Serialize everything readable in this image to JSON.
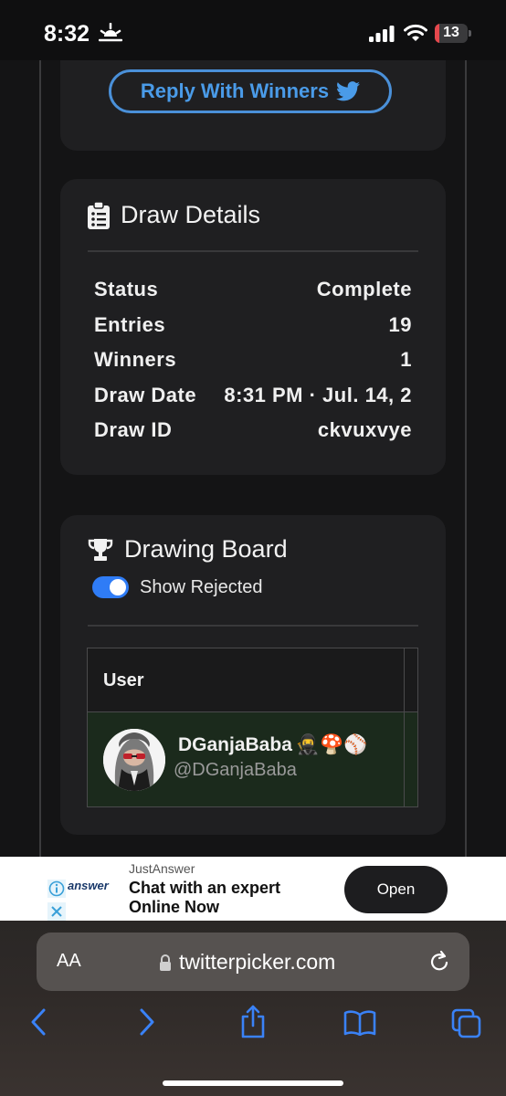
{
  "status_bar": {
    "time": "8:32",
    "battery": "13",
    "battery_level": 0.13
  },
  "card_top": {
    "reply_button": "Reply With Winners"
  },
  "draw_details": {
    "title": "Draw Details",
    "rows": [
      {
        "label": "Status",
        "value": "Complete"
      },
      {
        "label": "Entries",
        "value": "19"
      },
      {
        "label": "Winners",
        "value": "1"
      },
      {
        "label": "Draw Date",
        "value": "8:31 PM · Jul. 14, 2"
      },
      {
        "label": "Draw ID",
        "value": "ckvuxvye"
      }
    ]
  },
  "drawing_board": {
    "title": "Drawing Board",
    "toggle_label": "Show Rejected",
    "toggle_on": true,
    "column_user": "User",
    "rows": [
      {
        "name": "DGanjaBaba",
        "emojis": "🥷🍄⚾",
        "handle": "@DGanjaBaba"
      }
    ]
  },
  "ad": {
    "brand": "JustAnswer",
    "logo_text": "answer",
    "headline": "Chat with an expert Online Now",
    "button": "Open"
  },
  "safari": {
    "aa": "AA",
    "url": "twitterpicker.com"
  },
  "colors": {
    "accent_blue": "#4a9be8",
    "toggle_blue": "#2f7cf6",
    "battery_red": "#e5484d"
  }
}
